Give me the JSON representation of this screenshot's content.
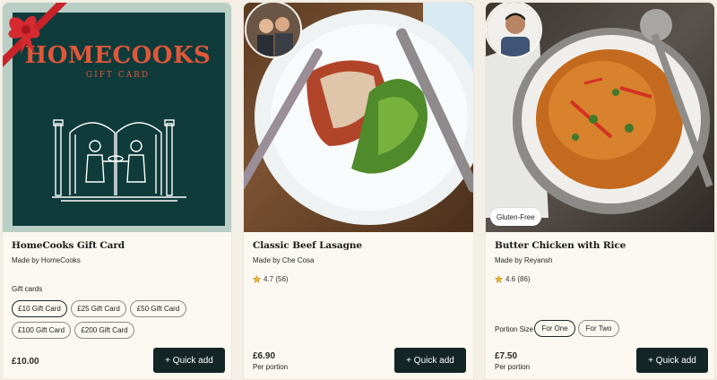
{
  "cards": [
    {
      "title": "HomeCooks Gift Card",
      "maker": "Made by HomeCooks",
      "logo_title": "HOMECOOKS",
      "logo_subtitle": "GIFT CARD",
      "options_label": "Gift cards",
      "options": [
        "£10 Gift Card",
        "£25 Gift Card",
        "£50 Gift Card",
        "£100 Gift Card",
        "£200 Gift Card"
      ],
      "selected_option": "£10 Gift Card",
      "price": "£10.00",
      "quick_add": "+ Quick add"
    },
    {
      "title": "Classic Beef Lasagne",
      "maker": "Made by Che Cosa",
      "rating": "4.7 (56)",
      "price": "£6.90",
      "per": "Per portion",
      "quick_add": "+ Quick add"
    },
    {
      "title": "Butter Chicken with Rice",
      "maker": "Made by Reyansh",
      "badge": "Gluten-Free",
      "rating": "4.6 (86)",
      "portion_label": "Portion Size",
      "portions": [
        "For One",
        "For Two"
      ],
      "selected_portion": "For One",
      "price": "£7.50",
      "per": "Per portion",
      "quick_add": "+ Quick add"
    }
  ],
  "colors": {
    "gift_bg": "#0f3b3b",
    "gift_frame": "#b9cfc6",
    "brand_orange": "#e1573a",
    "button_dark": "#132524",
    "card_bg": "#fbf8f1",
    "star": "#f0b429"
  }
}
